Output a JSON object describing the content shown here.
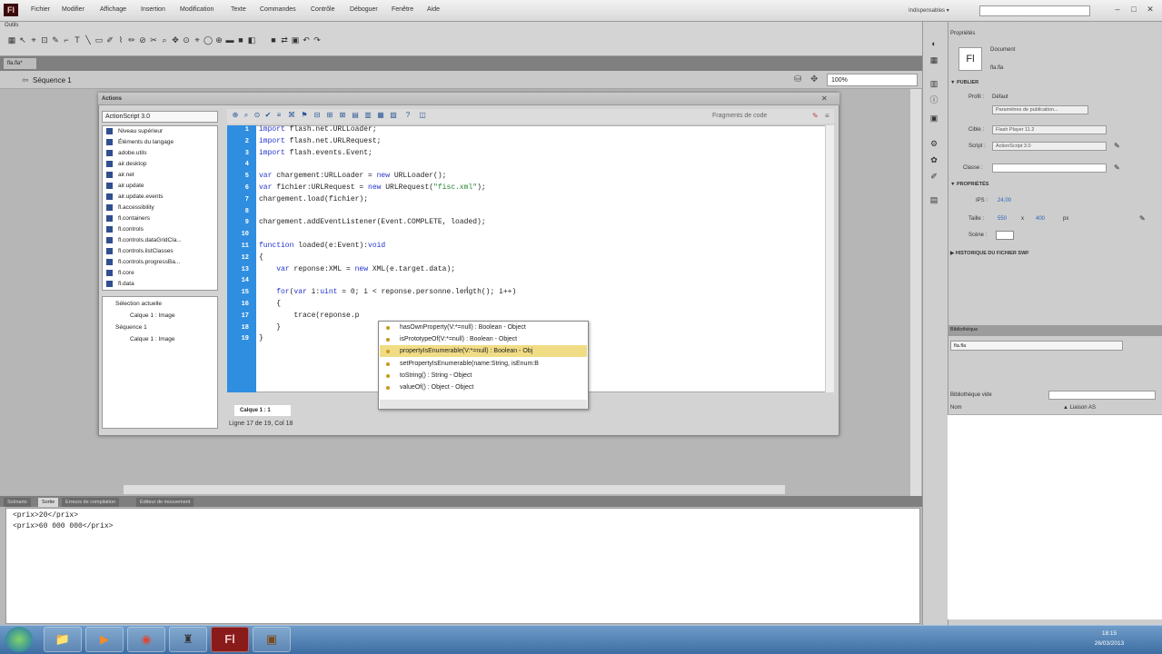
{
  "app": {
    "logo": "Fl"
  },
  "menu": [
    "Fichier",
    "Modifier",
    "Affichage",
    "Insertion",
    "Modification",
    "Texte",
    "Commandes",
    "Contrôle",
    "Déboguer",
    "Fenêtre",
    "Aide"
  ],
  "workspace": "Indispensables ▾",
  "window_controls": {
    "minimize": "–",
    "maximize": "□",
    "close": "✕"
  },
  "toolbox": {
    "tab": "Outils",
    "tools": [
      "▦",
      "↖",
      "⌖",
      "⊡",
      "✎",
      "⌐",
      "T",
      "╲",
      "▭",
      "✐",
      "⌇",
      "✏",
      "⊘",
      "✂",
      "⌕",
      "✥",
      "⊙",
      "⌖",
      "◯",
      "⊕",
      "▬",
      "■",
      "◧",
      "■",
      "⇄",
      "▣",
      "↶",
      "↷"
    ]
  },
  "document": {
    "tab": "fla.fla*",
    "scene": "Séquence 1",
    "zoom": "100%"
  },
  "actions_panel": {
    "tab": "Actions",
    "language": "ActionScript 3.0",
    "classes": [
      "Niveau supérieur",
      "Éléments du langage",
      "adobe.utils",
      "air.desktop",
      "air.net",
      "air.update",
      "air.update.events",
      "fl.accessibility",
      "fl.containers",
      "fl.controls",
      "fl.controls.dataGridCla...",
      "fl.controls.listClasses",
      "fl.controls.progressBa...",
      "fl.core",
      "fl.data"
    ],
    "script_nav": [
      "Sélection actuelle",
      "Calque 1 : Image",
      "Séquence 1",
      "Calque 1 : Image"
    ],
    "snippets_label": "Fragments de code",
    "line_numbers": [
      "1",
      "2",
      "3",
      "4",
      "5",
      "6",
      "7",
      "8",
      "9",
      "10",
      "11",
      "12",
      "13",
      "14",
      "15",
      "16",
      "17",
      "18",
      "19"
    ],
    "layer_tab": "Calque 1 : 1",
    "status": "Ligne 17 de 19, Col 18"
  },
  "code": [
    "import flash.net.URLLoader;",
    "import flash.net.URLRequest;",
    "import flash.events.Event;",
    "",
    "var chargement:URLLoader = new URLLoader();",
    "var fichier:URLRequest = new URLRequest(\"fisc.xml\");",
    "chargement.load(fichier);",
    "",
    "chargement.addEventListener(Event.COMPLETE, loaded);",
    "",
    "function loaded(e:Event):void",
    "{",
    "    var reponse:XML = new XML(e.target.data);",
    "",
    "    for(var i:uint = 0; i < reponse.personne.length(); i++)",
    "    {",
    "        trace(reponse.p",
    "    }",
    "}"
  ],
  "autocomplete": [
    "hasOwnProperty(V:*=null) : Boolean - Object",
    "isPrototypeOf(V:*=null) : Boolean - Object",
    "propertyIsEnumerable(V:*=null) : Boolean - Obj",
    "setPropertyIsEnumerable(name:String, isEnum:B",
    "toString() : String - Object",
    "valueOf() : Object - Object"
  ],
  "output_tabs": [
    "Scénario",
    "Sortie",
    "Erreurs de compilation",
    "Éditeur de mouvement"
  ],
  "output_lines": [
    "<prix>20</prix>",
    "<prix>60 000 000</prix>"
  ],
  "properties": {
    "tab": "Propriétés",
    "doc_icon": "Fl",
    "doc_type": "Document",
    "doc_name": "fla.fla",
    "section_publish": "▼ PUBLIER",
    "profile_label": "Profil :",
    "profile_value": "Défaut",
    "publish_settings": "Paramètres de publication...",
    "target_label": "Cible :",
    "target_value": "Flash Player 11.2",
    "script_label": "Script :",
    "script_value": "ActionScript 3.0",
    "class_label": "Classe :",
    "section_props": "▼ PROPRIÉTÉS",
    "fps_label": "IPS :",
    "fps_value": "24,00",
    "size_label": "Taille :",
    "size_w": "550",
    "size_x": "x",
    "size_h": "400",
    "size_unit": "px",
    "stage_label": "Scène :",
    "section_history": "▶ HISTORIQUE DU FICHIER SWF"
  },
  "library": {
    "tab": "Bibliothèque",
    "select": "fla.fla",
    "count": "Bibliothèque vide",
    "col_name": "Nom",
    "col_linkage": "▲ Liaison AS"
  },
  "taskbar": {
    "apps": [
      "📁",
      "▶",
      "◉",
      "♜",
      "Fl",
      "▣"
    ],
    "time": "18:15",
    "date": "26/03/2013"
  }
}
